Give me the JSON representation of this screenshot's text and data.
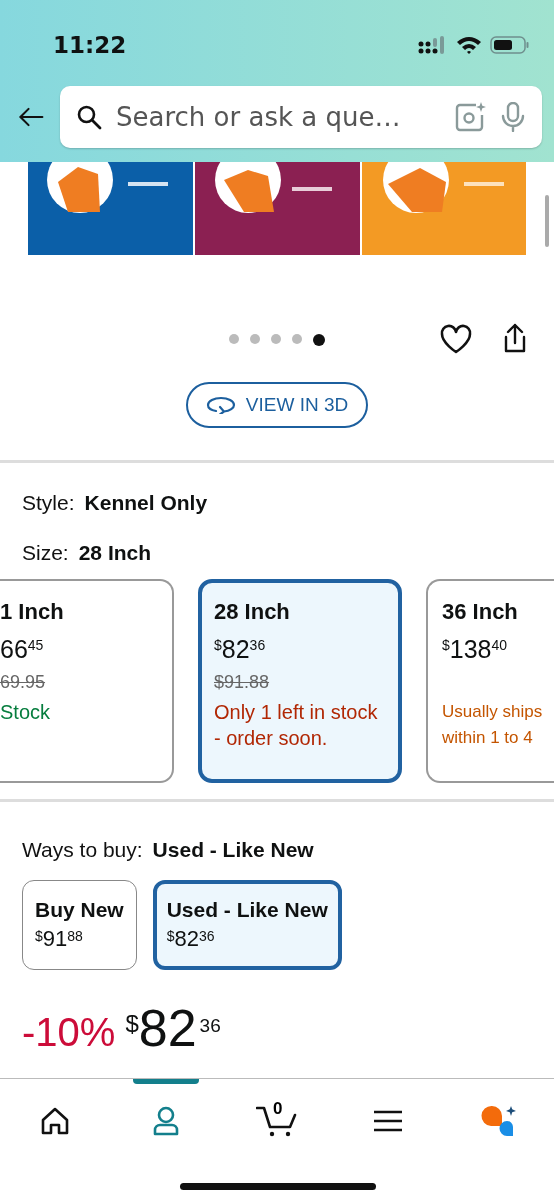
{
  "status_bar": {
    "time": "11:22"
  },
  "search": {
    "placeholder": "Search or ask a que…"
  },
  "gallery": {
    "dots": [
      {
        "selected": false
      },
      {
        "selected": false
      },
      {
        "selected": false
      },
      {
        "selected": false
      },
      {
        "selected": true
      }
    ],
    "view_3d": "VIEW IN 3D"
  },
  "style": {
    "label": "Style:",
    "value": "Kennel Only"
  },
  "size": {
    "label": "Size:",
    "value": "28 Inch",
    "options": [
      {
        "title": "1 Inch",
        "price": {
          "whole": "66",
          "fraction": "45"
        },
        "list_price": "69.95",
        "availability": "Stock",
        "kind": "in_stock",
        "selected": false
      },
      {
        "title": "28 Inch",
        "price": {
          "symbol": "$",
          "whole": "82",
          "fraction": "36"
        },
        "list_price": "$91.88",
        "availability": "Only 1 left in stock - order soon.",
        "kind": "low_stock",
        "selected": true
      },
      {
        "title": "36 Inch",
        "price": {
          "symbol": "$",
          "whole": "138",
          "fraction": "40"
        },
        "availability": "Usually ships within 1 to 4",
        "kind": "ships_later",
        "selected": false
      }
    ]
  },
  "ways_to_buy": {
    "label": "Ways to buy:",
    "value": "Used - Like New",
    "options": [
      {
        "title": "Buy New",
        "price": {
          "symbol": "$",
          "whole": "91",
          "fraction": "88"
        },
        "selected": false
      },
      {
        "title": "Used - Like New",
        "price": {
          "symbol": "$",
          "whole": "82",
          "fraction": "36"
        },
        "selected": true
      }
    ]
  },
  "deal": {
    "discount": "-10%",
    "price": {
      "symbol": "$",
      "whole": "82",
      "fraction": "36"
    }
  },
  "tab_bar": {
    "cart_count": "0",
    "tabs": [
      {
        "kind": "home",
        "selected": false
      },
      {
        "kind": "account",
        "selected": true
      },
      {
        "kind": "cart",
        "selected": false
      },
      {
        "kind": "menu",
        "selected": false
      },
      {
        "kind": "assistant",
        "selected": false
      }
    ]
  }
}
